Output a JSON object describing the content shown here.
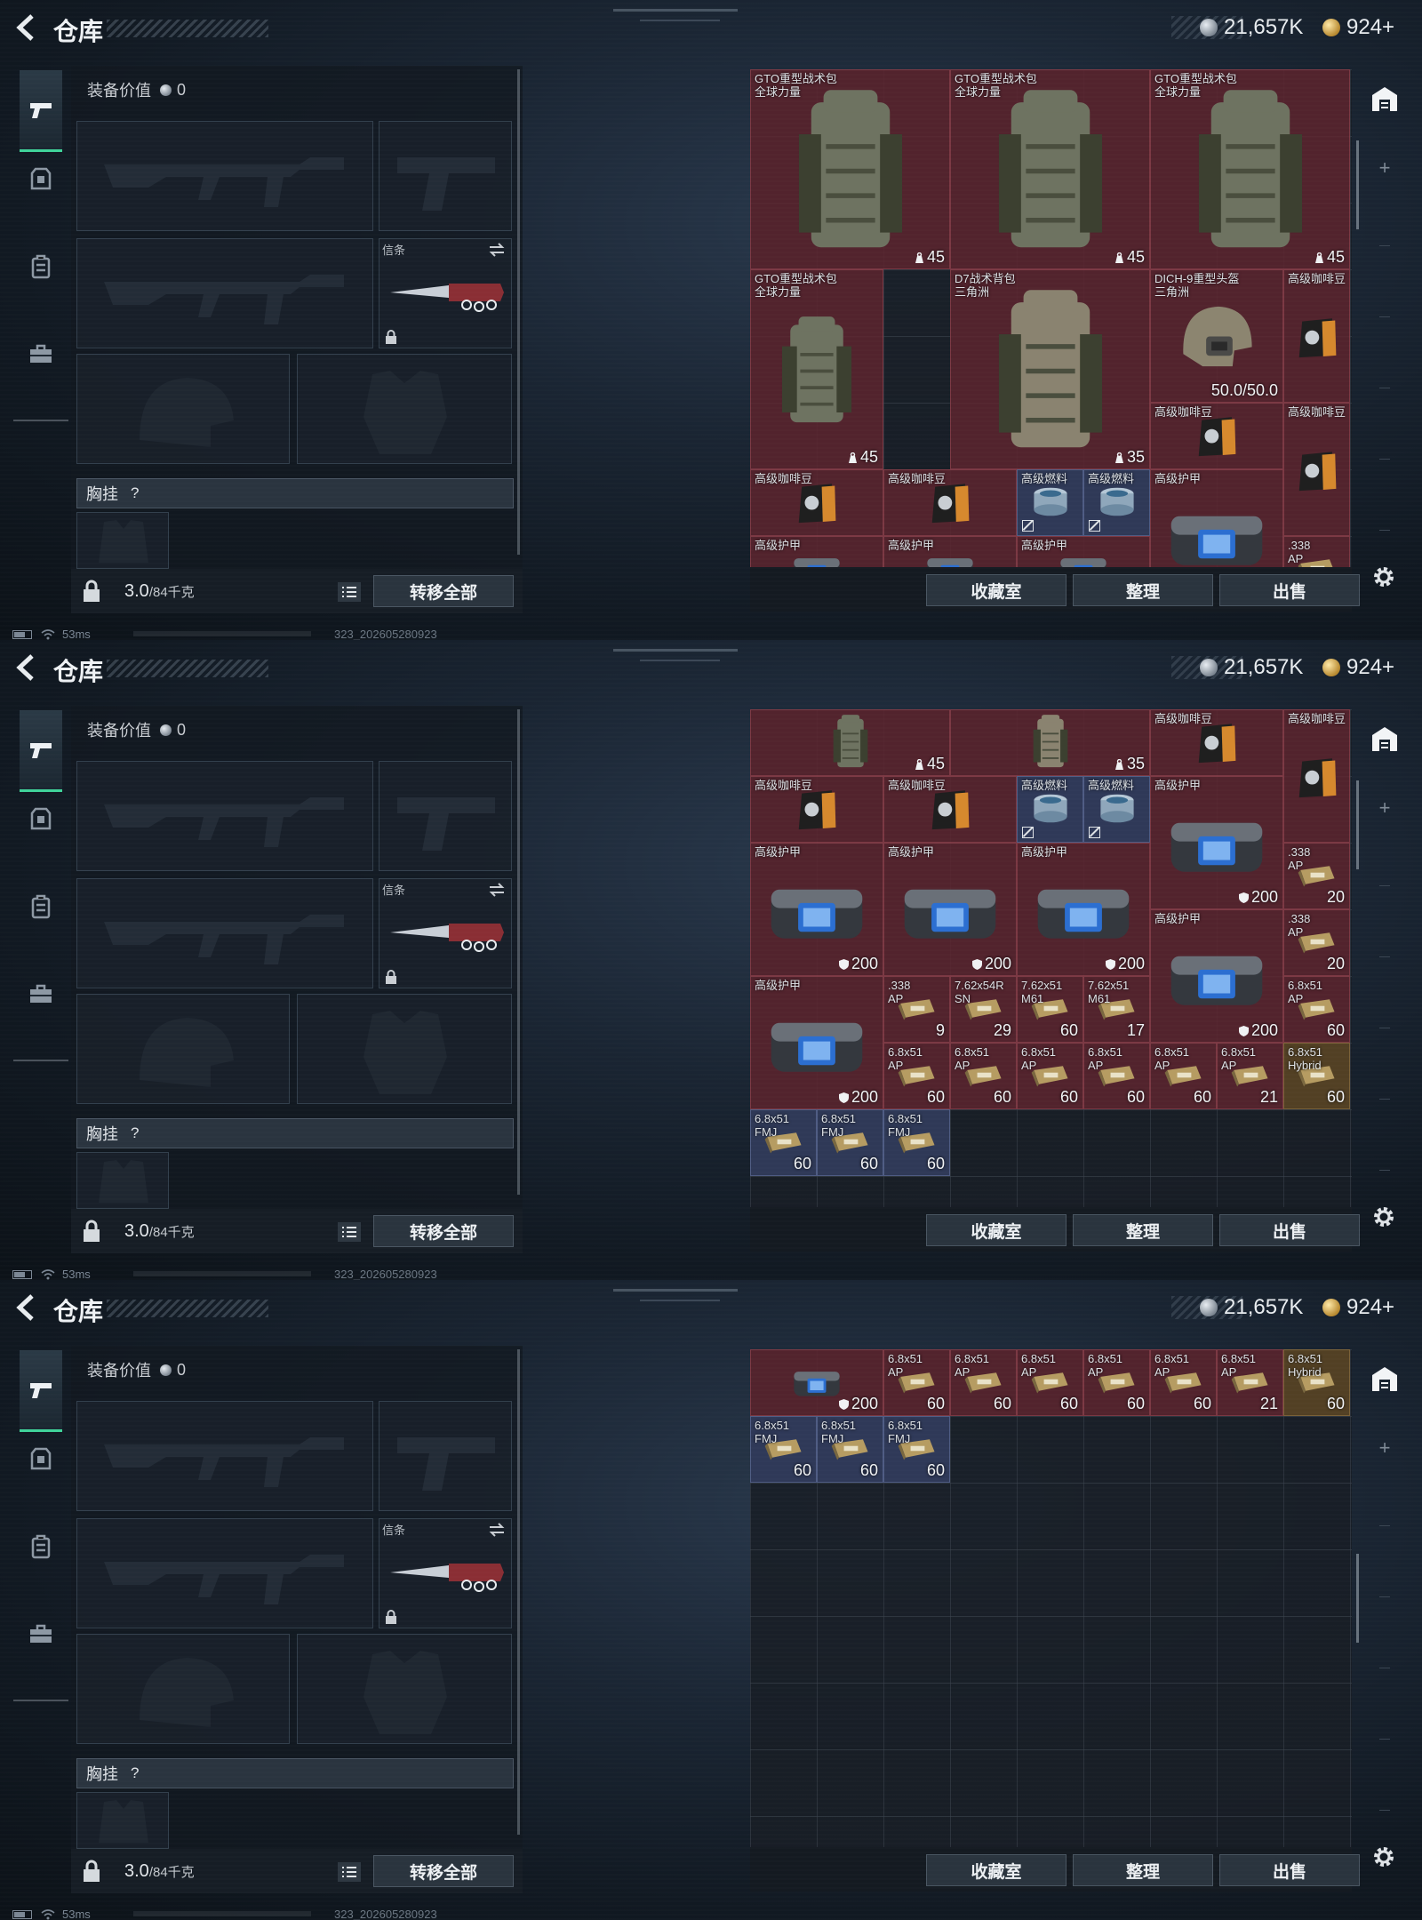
{
  "header": {
    "title": "仓库",
    "currency_silver": "21,657K",
    "currency_gold": "924+"
  },
  "equipment": {
    "value_label": "装备价值",
    "value": "0",
    "secure_slot_label": "信条",
    "chest_rig_label": "胸挂",
    "chest_rig_help": "?",
    "weight_value": "3.0",
    "weight_capacity": "/84千克",
    "transfer_all_label": "转移全部"
  },
  "storage": {
    "collection_label": "收藏室",
    "sort_label": "整理",
    "sell_label": "出售"
  },
  "status": {
    "ping": "53ms",
    "build": "323_202605280923"
  },
  "icons": {
    "back": "back-arrow-icon",
    "pistol": "pistol-icon",
    "armor": "armor-icon",
    "backpack": "backpack-icon",
    "toolbox": "toolbox-icon",
    "lock": "lock-icon",
    "list": "list-icon",
    "swap": "swap-icon",
    "gear": "gear-icon",
    "depot": "depot-icon",
    "weight": "weight-icon",
    "durability": "shield-icon",
    "silver": "silver-coin-icon",
    "gold": "gold-coin-icon"
  },
  "colors": {
    "accent": "#3fd49a",
    "item_red": "#5c242e",
    "item_blue": "#343e60",
    "item_gold": "#5c4624"
  },
  "screens": [
    {
      "items": [
        {
          "name": "GTO重型战术包\n全球力量",
          "qty": "45",
          "kind": "backpack",
          "color": "red",
          "col": 0,
          "row": 0,
          "w": 3,
          "h": 3,
          "weight": true
        },
        {
          "name": "GTO重型战术包\n全球力量",
          "qty": "45",
          "kind": "backpack",
          "color": "red",
          "col": 3,
          "row": 0,
          "w": 3,
          "h": 3,
          "weight": true
        },
        {
          "name": "GTO重型战术包\n全球力量",
          "qty": "45",
          "kind": "backpack",
          "color": "red",
          "col": 6,
          "row": 0,
          "w": 3,
          "h": 3,
          "weight": true
        },
        {
          "name": "GTO重型战术包\n全球力量",
          "qty": "45",
          "kind": "backpack",
          "color": "red",
          "col": 0,
          "row": 3,
          "w": 2,
          "h": 3,
          "weight": true
        },
        {
          "name": "D7战术背包\n三角洲",
          "qty": "35",
          "kind": "backpack2",
          "color": "red",
          "col": 3,
          "row": 3,
          "w": 3,
          "h": 3,
          "weight": true
        },
        {
          "name": "DICH-9重型头盔\n三角洲",
          "qty": "50.0/50.0",
          "kind": "helmet",
          "color": "red",
          "col": 6,
          "row": 3,
          "w": 2,
          "h": 2,
          "weight": false
        },
        {
          "name": "高级咖啡豆",
          "qty": "",
          "kind": "coffee",
          "color": "red",
          "col": 8,
          "row": 3,
          "w": 1,
          "h": 2,
          "weight": false
        },
        {
          "name": "高级咖啡豆",
          "qty": "",
          "kind": "coffee",
          "color": "red",
          "col": 6,
          "row": 5,
          "w": 2,
          "h": 1,
          "weight": false
        },
        {
          "name": "高级咖啡豆",
          "qty": "",
          "kind": "coffee",
          "color": "red",
          "col": 8,
          "row": 5,
          "w": 1,
          "h": 2,
          "weight": false
        },
        {
          "name": "高级咖啡豆",
          "qty": "",
          "kind": "coffee",
          "color": "red",
          "col": 0,
          "row": 6,
          "w": 2,
          "h": 1,
          "weight": false
        },
        {
          "name": "高级咖啡豆",
          "qty": "",
          "kind": "coffee",
          "color": "red",
          "col": 2,
          "row": 6,
          "w": 2,
          "h": 1,
          "weight": false
        },
        {
          "name": "高级燃料",
          "qty": "",
          "kind": "fuel",
          "color": "blue",
          "col": 4,
          "row": 6,
          "w": 1,
          "h": 1,
          "weight": false,
          "flag": true
        },
        {
          "name": "高级燃料",
          "qty": "",
          "kind": "fuel",
          "color": "blue",
          "col": 5,
          "row": 6,
          "w": 1,
          "h": 1,
          "weight": false,
          "flag": true
        },
        {
          "name": "高级护甲",
          "qty": "",
          "kind": "armor",
          "color": "red",
          "col": 6,
          "row": 6,
          "w": 2,
          "h": 2,
          "weight": false
        },
        {
          "name": "高级护甲",
          "qty": "",
          "kind": "armor",
          "color": "red",
          "col": 0,
          "row": 7,
          "w": 2,
          "h": 1,
          "weight": false
        },
        {
          "name": "高级护甲",
          "qty": "",
          "kind": "armor",
          "color": "red",
          "col": 2,
          "row": 7,
          "w": 2,
          "h": 1,
          "weight": false
        },
        {
          "name": "高级护甲",
          "qty": "",
          "kind": "armor",
          "color": "red",
          "col": 4,
          "row": 7,
          "w": 2,
          "h": 1,
          "weight": false
        },
        {
          "name": ".338\nAP",
          "qty": "",
          "kind": "ammo",
          "color": "red",
          "col": 8,
          "row": 7,
          "w": 1,
          "h": 1,
          "weight": false
        }
      ]
    },
    {
      "items": [
        {
          "name": "",
          "qty": "45",
          "kind": "backpack",
          "color": "red",
          "col": 0,
          "row": 0,
          "w": 3,
          "h": 1,
          "weight": true
        },
        {
          "name": "",
          "qty": "35",
          "kind": "backpack2",
          "color": "red",
          "col": 3,
          "row": 0,
          "w": 3,
          "h": 1,
          "weight": true
        },
        {
          "name": "高级咖啡豆",
          "qty": "",
          "kind": "coffee",
          "color": "red",
          "col": 6,
          "row": 0,
          "w": 2,
          "h": 1,
          "weight": false
        },
        {
          "name": "高级咖啡豆",
          "qty": "",
          "kind": "coffee",
          "color": "red",
          "col": 8,
          "row": 0,
          "w": 1,
          "h": 2,
          "weight": false
        },
        {
          "name": "高级咖啡豆",
          "qty": "",
          "kind": "coffee",
          "color": "red",
          "col": 0,
          "row": 1,
          "w": 2,
          "h": 1,
          "weight": false
        },
        {
          "name": "高级咖啡豆",
          "qty": "",
          "kind": "coffee",
          "color": "red",
          "col": 2,
          "row": 1,
          "w": 2,
          "h": 1,
          "weight": false
        },
        {
          "name": "高级燃料",
          "qty": "",
          "kind": "fuel",
          "color": "blue",
          "col": 4,
          "row": 1,
          "w": 1,
          "h": 1,
          "weight": false,
          "flag": true
        },
        {
          "name": "高级燃料",
          "qty": "",
          "kind": "fuel",
          "color": "blue",
          "col": 5,
          "row": 1,
          "w": 1,
          "h": 1,
          "weight": false,
          "flag": true
        },
        {
          "name": "高级护甲",
          "qty": "200",
          "kind": "armor",
          "color": "red",
          "col": 6,
          "row": 1,
          "w": 2,
          "h": 2,
          "weight": false,
          "shield": true
        },
        {
          "name": ".338\nAP",
          "qty": "20",
          "kind": "ammo",
          "color": "red",
          "col": 8,
          "row": 2,
          "w": 1,
          "h": 1,
          "weight": false
        },
        {
          "name": "高级护甲",
          "qty": "200",
          "kind": "armor",
          "color": "red",
          "col": 0,
          "row": 2,
          "w": 2,
          "h": 2,
          "weight": false,
          "shield": true
        },
        {
          "name": "高级护甲",
          "qty": "200",
          "kind": "armor",
          "color": "red",
          "col": 2,
          "row": 2,
          "w": 2,
          "h": 2,
          "weight": false,
          "shield": true
        },
        {
          "name": "高级护甲",
          "qty": "200",
          "kind": "armor",
          "color": "red",
          "col": 4,
          "row": 2,
          "w": 2,
          "h": 2,
          "weight": false,
          "shield": true
        },
        {
          "name": "高级护甲",
          "qty": "200",
          "kind": "armor",
          "color": "red",
          "col": 6,
          "row": 3,
          "w": 2,
          "h": 2,
          "weight": false,
          "shield": true
        },
        {
          "name": ".338\nAP",
          "qty": "20",
          "kind": "ammo",
          "color": "red",
          "col": 8,
          "row": 3,
          "w": 1,
          "h": 1,
          "weight": false
        },
        {
          "name": "高级护甲",
          "qty": "200",
          "kind": "armor",
          "color": "red",
          "col": 0,
          "row": 4,
          "w": 2,
          "h": 2,
          "weight": false,
          "shield": true
        },
        {
          "name": ".338\nAP",
          "qty": "9",
          "kind": "ammo",
          "color": "red",
          "col": 2,
          "row": 4,
          "w": 1,
          "h": 1,
          "weight": false
        },
        {
          "name": "7.62x54R\nSN",
          "qty": "29",
          "kind": "ammo",
          "color": "red",
          "col": 3,
          "row": 4,
          "w": 1,
          "h": 1,
          "weight": false
        },
        {
          "name": "7.62x51\nM61",
          "qty": "60",
          "kind": "ammo",
          "color": "red",
          "col": 4,
          "row": 4,
          "w": 1,
          "h": 1,
          "weight": false
        },
        {
          "name": "7.62x51\nM61",
          "qty": "17",
          "kind": "ammo",
          "color": "red",
          "col": 5,
          "row": 4,
          "w": 1,
          "h": 1,
          "weight": false
        },
        {
          "name": "6.8x51\nAP",
          "qty": "60",
          "kind": "ammo",
          "color": "red",
          "col": 8,
          "row": 4,
          "w": 1,
          "h": 1,
          "weight": false
        },
        {
          "name": "6.8x51\nAP",
          "qty": "60",
          "kind": "ammo",
          "color": "red",
          "col": 2,
          "row": 5,
          "w": 1,
          "h": 1,
          "weight": false
        },
        {
          "name": "6.8x51\nAP",
          "qty": "60",
          "kind": "ammo",
          "color": "red",
          "col": 3,
          "row": 5,
          "w": 1,
          "h": 1,
          "weight": false
        },
        {
          "name": "6.8x51\nAP",
          "qty": "60",
          "kind": "ammo",
          "color": "red",
          "col": 4,
          "row": 5,
          "w": 1,
          "h": 1,
          "weight": false
        },
        {
          "name": "6.8x51\nAP",
          "qty": "60",
          "kind": "ammo",
          "color": "red",
          "col": 5,
          "row": 5,
          "w": 1,
          "h": 1,
          "weight": false
        },
        {
          "name": "6.8x51\nAP",
          "qty": "60",
          "kind": "ammo",
          "color": "red",
          "col": 6,
          "row": 5,
          "w": 1,
          "h": 1,
          "weight": false
        },
        {
          "name": "6.8x51\nAP",
          "qty": "21",
          "kind": "ammo",
          "color": "red",
          "col": 7,
          "row": 5,
          "w": 1,
          "h": 1,
          "weight": false
        },
        {
          "name": "6.8x51\nHybrid",
          "qty": "60",
          "kind": "ammo",
          "color": "gold",
          "col": 8,
          "row": 5,
          "w": 1,
          "h": 1,
          "weight": false
        },
        {
          "name": "6.8x51\nFMJ",
          "qty": "60",
          "kind": "ammo",
          "color": "blue",
          "col": 0,
          "row": 6,
          "w": 1,
          "h": 1,
          "weight": false
        },
        {
          "name": "6.8x51\nFMJ",
          "qty": "60",
          "kind": "ammo",
          "color": "blue",
          "col": 1,
          "row": 6,
          "w": 1,
          "h": 1,
          "weight": false
        },
        {
          "name": "6.8x51\nFMJ",
          "qty": "60",
          "kind": "ammo",
          "color": "blue",
          "col": 2,
          "row": 6,
          "w": 1,
          "h": 1,
          "weight": false
        }
      ]
    },
    {
      "items": [
        {
          "name": "",
          "qty": "200",
          "kind": "armor",
          "color": "red",
          "col": 0,
          "row": 0,
          "w": 2,
          "h": 1,
          "weight": false,
          "shield": true
        },
        {
          "name": "6.8x51\nAP",
          "qty": "60",
          "kind": "ammo",
          "color": "red",
          "col": 2,
          "row": 0,
          "w": 1,
          "h": 1,
          "weight": false
        },
        {
          "name": "6.8x51\nAP",
          "qty": "60",
          "kind": "ammo",
          "color": "red",
          "col": 3,
          "row": 0,
          "w": 1,
          "h": 1,
          "weight": false
        },
        {
          "name": "6.8x51\nAP",
          "qty": "60",
          "kind": "ammo",
          "color": "red",
          "col": 4,
          "row": 0,
          "w": 1,
          "h": 1,
          "weight": false
        },
        {
          "name": "6.8x51\nAP",
          "qty": "60",
          "kind": "ammo",
          "color": "red",
          "col": 5,
          "row": 0,
          "w": 1,
          "h": 1,
          "weight": false
        },
        {
          "name": "6.8x51\nAP",
          "qty": "60",
          "kind": "ammo",
          "color": "red",
          "col": 6,
          "row": 0,
          "w": 1,
          "h": 1,
          "weight": false
        },
        {
          "name": "6.8x51\nAP",
          "qty": "21",
          "kind": "ammo",
          "color": "red",
          "col": 7,
          "row": 0,
          "w": 1,
          "h": 1,
          "weight": false
        },
        {
          "name": "6.8x51\nHybrid",
          "qty": "60",
          "kind": "ammo",
          "color": "gold",
          "col": 8,
          "row": 0,
          "w": 1,
          "h": 1,
          "weight": false
        },
        {
          "name": "6.8x51\nFMJ",
          "qty": "60",
          "kind": "ammo",
          "color": "blue",
          "col": 0,
          "row": 1,
          "w": 1,
          "h": 1,
          "weight": false
        },
        {
          "name": "6.8x51\nFMJ",
          "qty": "60",
          "kind": "ammo",
          "color": "blue",
          "col": 1,
          "row": 1,
          "w": 1,
          "h": 1,
          "weight": false
        },
        {
          "name": "6.8x51\nFMJ",
          "qty": "60",
          "kind": "ammo",
          "color": "blue",
          "col": 2,
          "row": 1,
          "w": 1,
          "h": 1,
          "weight": false
        }
      ]
    }
  ]
}
